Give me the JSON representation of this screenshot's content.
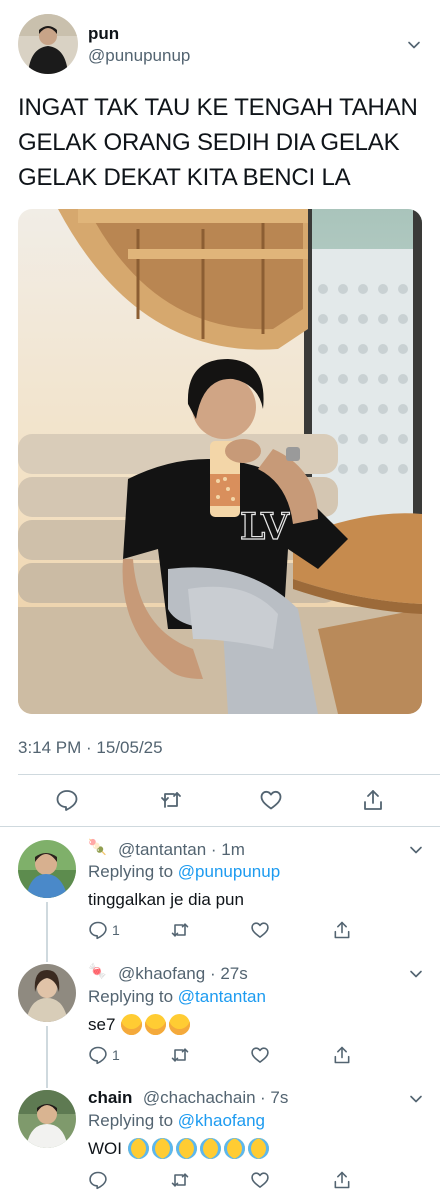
{
  "tweet": {
    "author_name": "pun",
    "author_handle": "@punupunup",
    "text_line1": "INGAT TAK TAU KE TENGAH TAHAN",
    "text_line2": "GELAK ORANG SEDIH DIA GELAK",
    "text_line3": "GELAK DEKAT KITA BENCI LA",
    "timestamp": "3:14 PM · 15/05/25"
  },
  "replies": [
    {
      "emoji": "🍡",
      "name": "",
      "handle": "@tantantan",
      "time": "· 1m",
      "replying_prefix": "Replying to",
      "replying_to": "@punupunup",
      "text": "tinggalkan je dia pun",
      "reply_count": "1"
    },
    {
      "emoji": "🍬",
      "name": "",
      "handle": "@khaofang",
      "time": "· 27s",
      "replying_prefix": "Replying to",
      "replying_to": "@tantantan",
      "text": "se7",
      "reply_count": "1"
    },
    {
      "emoji": "",
      "name": "chain",
      "handle": "@chachachain",
      "time": "· 7s",
      "replying_prefix": "Replying to",
      "replying_to": "@khaofang",
      "text": "WOI",
      "reply_count": ""
    }
  ],
  "icons": [
    "chevron-down-icon",
    "reply-icon",
    "retweet-icon",
    "like-icon",
    "share-icon"
  ],
  "colors": {
    "text": "#0f1419",
    "secondary": "#536471",
    "link": "#1d9bf0",
    "divider": "#cfd9de"
  }
}
